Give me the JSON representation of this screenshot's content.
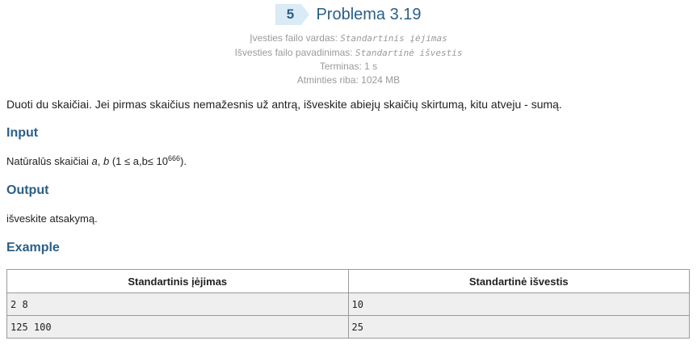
{
  "header": {
    "badge_number": "5",
    "title": "Problema 3.19"
  },
  "meta": {
    "input_file_label": "Įvesties failo vardas:",
    "input_file_value": "Standartinis įėjimas",
    "output_file_label": "Išvesties failo pavadinimas:",
    "output_file_value": "Standartinė išvestis",
    "time_limit": "Terminas: 1 s",
    "memory_limit": "Atminties riba: 1024 MB"
  },
  "statement": "Duoti du skaičiai. Jei pirmas skaičius nemažesnis už antrą, išveskite abiejų skaičių skirtumą, kitu atveju - sumą.",
  "input_section": {
    "title": "Input",
    "text_prefix": "Natūralūs skaičiai ",
    "var_a": "a",
    "comma": ", ",
    "var_b": "b",
    "constraint": " (1 ≤ a,b≤ 10",
    "exponent": "666",
    "closing": ")."
  },
  "output_section": {
    "title": "Output",
    "text": "išveskite atsakymą."
  },
  "example_section": {
    "title": "Example",
    "headers": [
      "Standartinis įėjimas",
      "Standartinė išvestis"
    ],
    "rows": [
      [
        "2 8",
        "10"
      ],
      [
        "125 100",
        "25"
      ]
    ]
  },
  "colors": {
    "accent": "#2a5f86",
    "badge_bg": "#d9ebf5",
    "meta_text": "#9a9a9a",
    "table_cell_bg": "#efefef"
  }
}
